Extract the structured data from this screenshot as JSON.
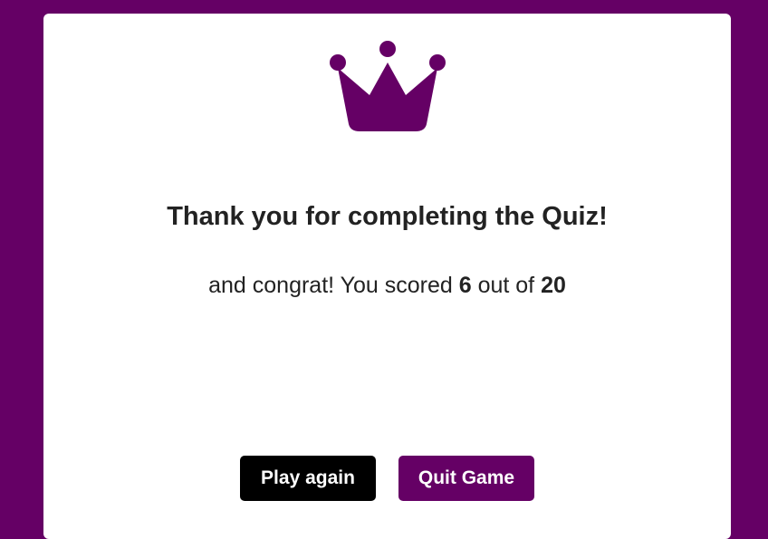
{
  "colors": {
    "background": "#650065",
    "accent": "#650065",
    "play_button": "#000000",
    "text": "#222222"
  },
  "icon": "crown-icon",
  "result": {
    "title": "Thank you for completing the Quiz!",
    "prefix": "and congrat! You scored ",
    "score": "6",
    "middle": " out of ",
    "total": "20"
  },
  "buttons": {
    "play_again": "Play again",
    "quit": "Quit Game"
  }
}
